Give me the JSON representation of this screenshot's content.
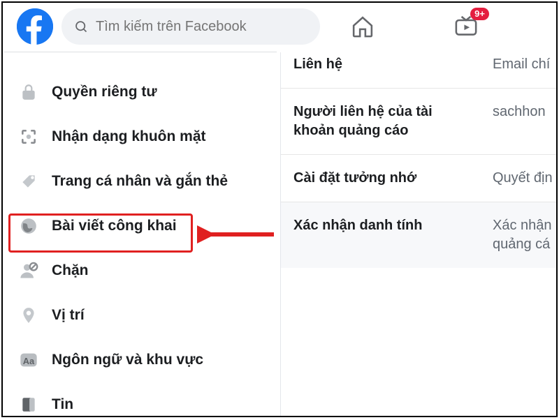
{
  "header": {
    "search_placeholder": "Tìm kiếm trên Facebook",
    "badge": "9+"
  },
  "sidebar": {
    "items": [
      {
        "label": "Quyền riêng tư",
        "icon": "lock-icon"
      },
      {
        "label": "Nhận dạng khuôn mặt",
        "icon": "face-id-icon"
      },
      {
        "label": "Trang cá nhân và gắn thẻ",
        "icon": "tag-icon"
      },
      {
        "label": "Bài viết công khai",
        "icon": "globe-icon"
      },
      {
        "label": "Chặn",
        "icon": "block-user-icon"
      },
      {
        "label": "Vị trí",
        "icon": "location-pin-icon"
      },
      {
        "label": "Ngôn ngữ và khu vực",
        "icon": "language-icon"
      },
      {
        "label": "Tin",
        "icon": "news-icon"
      }
    ]
  },
  "content": {
    "rows": [
      {
        "label": "Liên hệ",
        "value": "Email chí"
      },
      {
        "label": "Người liên hệ của tài khoản quảng cáo",
        "value": "sachhon"
      },
      {
        "label": "Cài đặt tưởng nhớ",
        "value": "Quyết địn"
      },
      {
        "label": "Xác nhận danh tính",
        "value": "Xác nhận\nquảng cá"
      }
    ]
  }
}
